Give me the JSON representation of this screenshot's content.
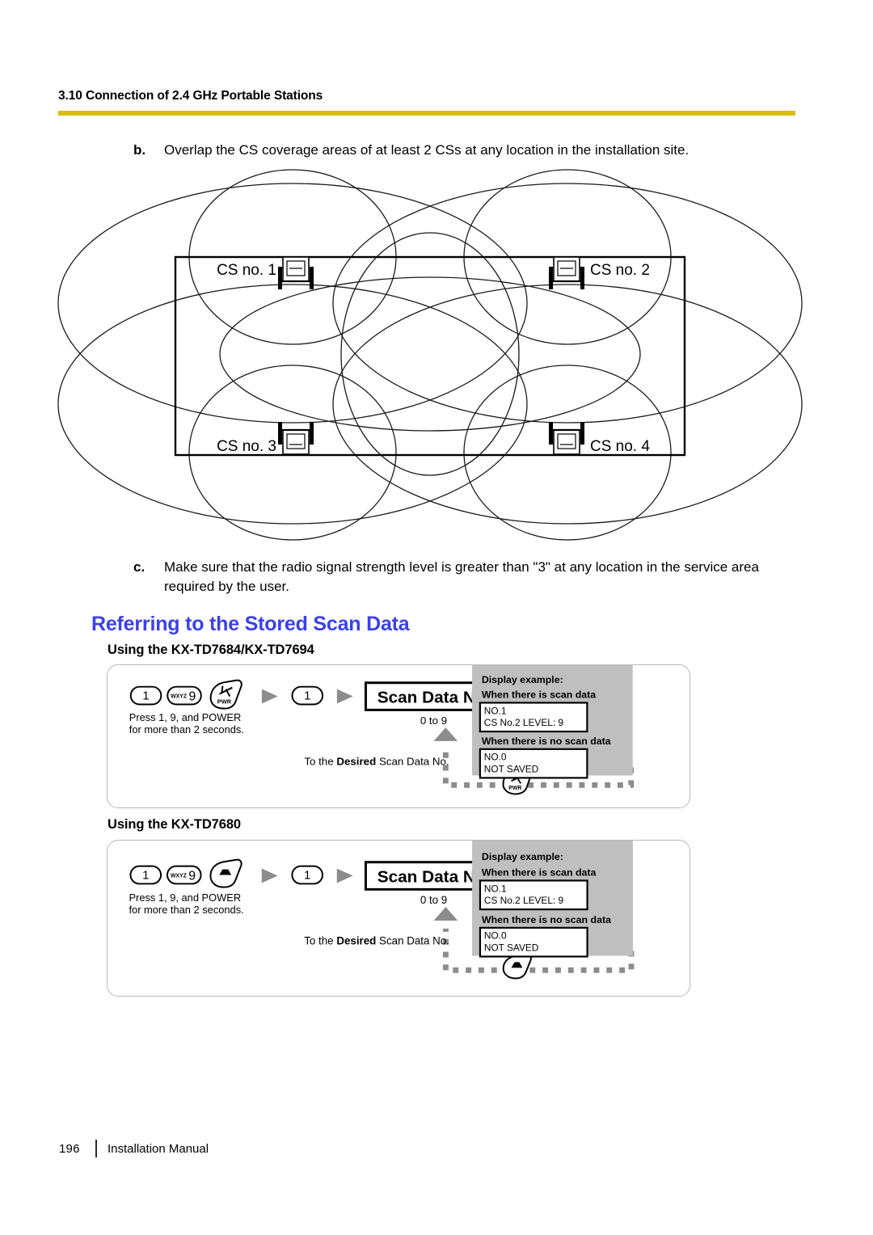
{
  "header": {
    "section_title": "3.10 Connection of 2.4 GHz Portable Stations",
    "rule_color": "#d8bd0c"
  },
  "steps": [
    {
      "label": "b.",
      "text": "Overlap the CS coverage areas of at least 2 CSs at any location in the installation site."
    },
    {
      "label": "c.",
      "text": "Make sure that the radio signal strength level is greater than \"3\" at any location in the service area required by the user."
    }
  ],
  "coverage_diagram": {
    "name": "cs-coverage-overlap-diagram",
    "site_boundary": "rectangle",
    "stations": [
      {
        "label": "CS no. 1",
        "corner": "top-left"
      },
      {
        "label": "CS no. 2",
        "corner": "top-right"
      },
      {
        "label": "CS no. 3",
        "corner": "bottom-left"
      },
      {
        "label": "CS no. 4",
        "corner": "bottom-right"
      }
    ]
  },
  "headings": {
    "blue_title": "Referring to the Stored Scan Data",
    "sub_1": "Using the KX-TD7684/KX-TD7694",
    "sub_2": "Using the KX-TD7680",
    "blue_color": "#3b41e8"
  },
  "procedures": [
    {
      "id": "kx-td7684-7694",
      "keys": [
        {
          "icon": "key-1-icon",
          "label": "1",
          "sub": ""
        },
        {
          "icon": "key-9-icon",
          "label": "9",
          "sub": "WXYZ"
        },
        {
          "icon": "power-antenna-key-icon",
          "label": "PWR",
          "sub": ""
        }
      ],
      "press_note": "Press 1, 9, and POWER\nfor more than 2 seconds.",
      "press_note_line1": "Press 1, 9, and POWER",
      "press_note_line2": "for more than 2 seconds.",
      "second_key": {
        "icon": "key-1-icon",
        "label": "1"
      },
      "field_box": "Scan Data No.",
      "field_range": "0 to 9",
      "end_key": {
        "icon": "talk-handset-key-icon",
        "label": ""
      },
      "loop_note_prefix": "To the ",
      "loop_note_bold": "Desired",
      "loop_note_suffix": " Scan Data No.",
      "loop_key": {
        "icon": "power-antenna-key-icon",
        "label": "PWR"
      },
      "display": {
        "title": "Display example:",
        "case_1_title": "When there is scan data",
        "case_1_line_1": "NO.1",
        "case_1_line_2": "CS No.2 LEVEL: 9",
        "case_2_title": "When there is no scan data",
        "case_2_line_1": "NO.0",
        "case_2_line_2": "NOT SAVED",
        "panel_color": "#bfbfbf"
      }
    },
    {
      "id": "kx-td7680",
      "keys": [
        {
          "icon": "key-1-icon",
          "label": "1",
          "sub": ""
        },
        {
          "icon": "key-9-icon",
          "label": "9",
          "sub": "WXYZ"
        },
        {
          "icon": "power-off-key-icon",
          "label": "",
          "sub": ""
        }
      ],
      "press_note_line1": "Press 1, 9, and POWER",
      "press_note_line2": "for more than 2 seconds.",
      "second_key": {
        "icon": "key-1-icon",
        "label": "1"
      },
      "field_box": "Scan Data No.",
      "field_range": "0 to 9",
      "end_key": {
        "icon": "talk-handset-oval-key-icon",
        "label": ""
      },
      "loop_note_prefix": "To the ",
      "loop_note_bold": "Desired",
      "loop_note_suffix": " Scan Data No.",
      "loop_key": {
        "icon": "power-off-key-icon",
        "label": ""
      },
      "display": {
        "title": "Display example:",
        "case_1_title": "When there is scan data",
        "case_1_line_1": "NO.1",
        "case_1_line_2": "CS No.2 LEVEL: 9",
        "case_2_title": "When there is no scan data",
        "case_2_line_1": "NO.0",
        "case_2_line_2": "NOT SAVED",
        "panel_color": "#bfbfbf"
      }
    }
  ],
  "footer": {
    "page_number": "196",
    "manual_title": "Installation Manual"
  }
}
